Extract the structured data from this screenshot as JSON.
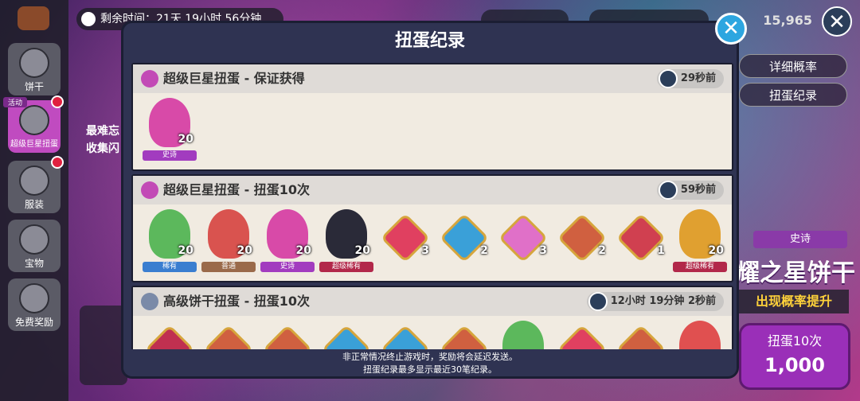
{
  "top": {
    "timer_text": "剩余时间：21天 19小时 56分钟",
    "coin_count": "15,965"
  },
  "sidebar": {
    "items": [
      {
        "label": "饼干",
        "icon": "cookie-face-icon"
      },
      {
        "label": "超级巨星扭蛋",
        "icon": "cookie-face-icon",
        "tag": "活动"
      },
      {
        "label": "服装",
        "icon": "shirt-icon"
      },
      {
        "label": "宝物",
        "icon": "hexagon-icon"
      },
      {
        "label": "免费奖励",
        "icon": "gift-icon"
      }
    ]
  },
  "background": {
    "left_text_1": "最难忘",
    "left_text_2": "收集闪",
    "right_buttons": [
      "详细概率",
      "扭蛋纪录"
    ],
    "epic_tag": "史诗",
    "featured_title": "耀之星饼干",
    "rate_up": "出现概率提升",
    "pull10_label": "扭蛋10次",
    "pull10_price": "1,000"
  },
  "modal": {
    "title": "扭蛋纪录",
    "entries": [
      {
        "title": "超级巨星扭蛋 - 保证获得",
        "time": "29秒前",
        "items": [
          {
            "kind": "cookie",
            "count": "20",
            "rarity": "史诗",
            "rarity_color": "#a23cbf",
            "color": "#d84aa8"
          }
        ]
      },
      {
        "title": "超级巨星扭蛋 - 扭蛋10次",
        "time": "59秒前",
        "items": [
          {
            "kind": "cookie",
            "count": "20",
            "rarity": "稀有",
            "rarity_color": "#3a7ed0",
            "color": "#5cb85c"
          },
          {
            "kind": "cookie",
            "count": "20",
            "rarity": "普通",
            "rarity_color": "#9a6a4a",
            "color": "#d9534f"
          },
          {
            "kind": "cookie",
            "count": "20",
            "rarity": "史诗",
            "rarity_color": "#a23cbf",
            "color": "#d84aa8"
          },
          {
            "kind": "cookie",
            "count": "20",
            "rarity": "超级稀有",
            "rarity_color": "#b2284a",
            "color": "#2a2a38"
          },
          {
            "kind": "gem",
            "count": "3",
            "rarity": "",
            "rarity_color": "",
            "color": "#e04060"
          },
          {
            "kind": "gem",
            "count": "2",
            "rarity": "",
            "rarity_color": "",
            "color": "#3aa0d8"
          },
          {
            "kind": "gem",
            "count": "3",
            "rarity": "",
            "rarity_color": "",
            "color": "#e070c8"
          },
          {
            "kind": "gem",
            "count": "2",
            "rarity": "",
            "rarity_color": "",
            "color": "#d06040"
          },
          {
            "kind": "gem",
            "count": "1",
            "rarity": "",
            "rarity_color": "",
            "color": "#d04050"
          },
          {
            "kind": "cookie",
            "count": "20",
            "rarity": "超级稀有",
            "rarity_color": "#b2284a",
            "color": "#e0a030"
          }
        ]
      },
      {
        "title": "高级饼干扭蛋 - 扭蛋10次",
        "time": "12小时 19分钟 2秒前",
        "items": [
          {
            "kind": "gem",
            "count": "",
            "rarity": "",
            "rarity_color": "",
            "color": "#c03050"
          },
          {
            "kind": "gem",
            "count": "",
            "rarity": "",
            "rarity_color": "",
            "color": "#d06040"
          },
          {
            "kind": "gem",
            "count": "",
            "rarity": "",
            "rarity_color": "",
            "color": "#d06040"
          },
          {
            "kind": "gem",
            "count": "",
            "rarity": "",
            "rarity_color": "",
            "color": "#3aa0d8"
          },
          {
            "kind": "gem",
            "count": "",
            "rarity": "",
            "rarity_color": "",
            "color": "#3aa0d8"
          },
          {
            "kind": "gem",
            "count": "",
            "rarity": "",
            "rarity_color": "",
            "color": "#d06040"
          },
          {
            "kind": "cookie",
            "count": "",
            "rarity": "",
            "rarity_color": "",
            "color": "#5cb85c"
          },
          {
            "kind": "gem",
            "count": "",
            "rarity": "",
            "rarity_color": "",
            "color": "#e04060"
          },
          {
            "kind": "gem",
            "count": "",
            "rarity": "",
            "rarity_color": "",
            "color": "#d06040"
          },
          {
            "kind": "cookie",
            "count": "",
            "rarity": "",
            "rarity_color": "",
            "color": "#e05050"
          }
        ]
      }
    ],
    "footer_line1": "非正常情况终止游戏时，奖励将会延迟发送。",
    "footer_line2": "扭蛋纪录最多显示最近30笔纪录。"
  }
}
